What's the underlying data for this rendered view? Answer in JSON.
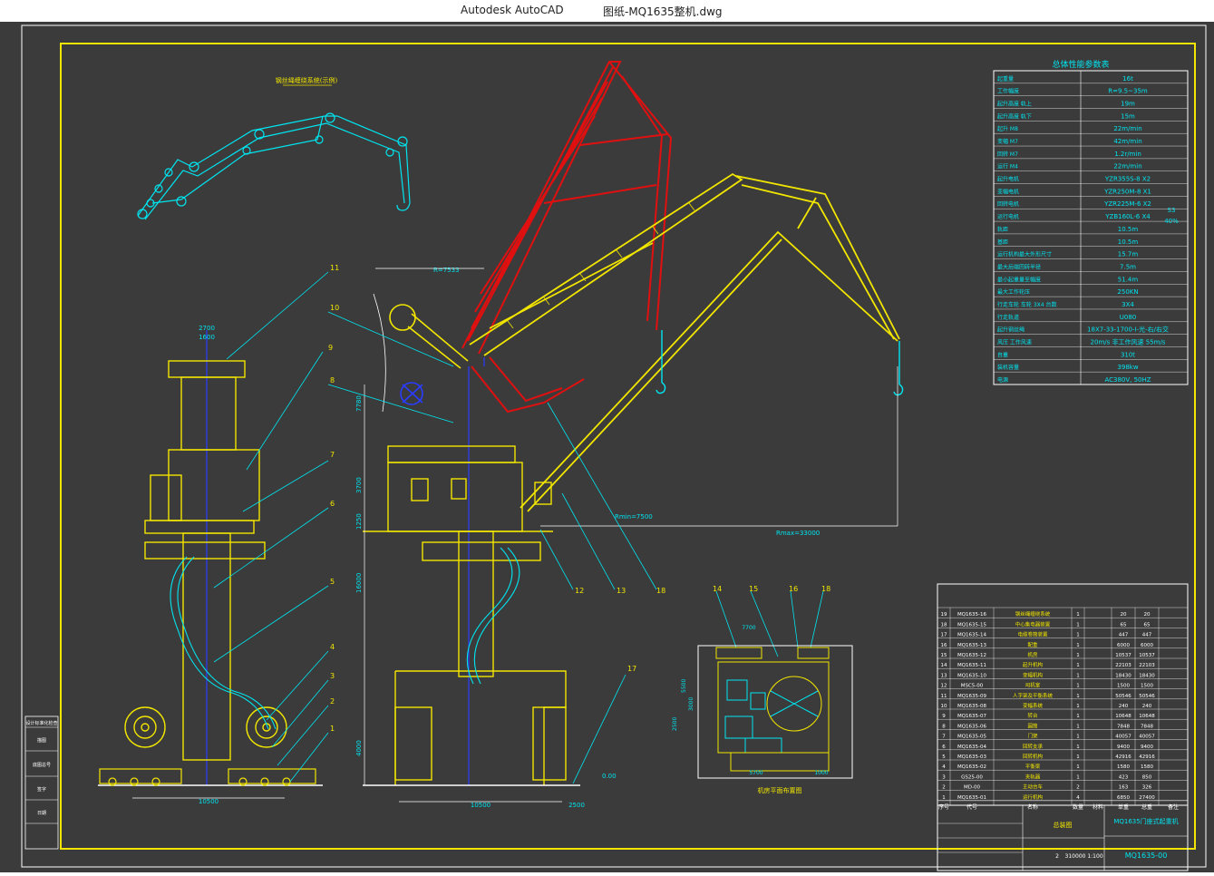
{
  "window": {
    "app_name": "Autodesk AutoCAD",
    "document_title": "图纸-MQ1635整机.dwg"
  },
  "colors": {
    "background": "#3b3b3b",
    "frame": "#ffffff",
    "border": "#f2e600",
    "cyan": "#00e5f0",
    "yellow": "#f2e600",
    "red": "#e01010",
    "blue": "#2a3cff",
    "green": "#2ee82e"
  },
  "drawing": {
    "small_caption": "钢丝绳缠绕系统(示例)",
    "dims": {
      "d2700": "2700",
      "d1600": "1600",
      "d7533": "R=7533",
      "d7780": "7780",
      "d3700": "3700",
      "d1250": "1250",
      "d16000": "16000",
      "d4000": "4000",
      "d10500a": "10500",
      "d10500b": "10500",
      "d2500": "2500",
      "d0": "0.00",
      "rmin": "Rmin=7500",
      "rmax": "Rmax=33000"
    },
    "callouts": [
      "11",
      "10",
      "9",
      "8",
      "7",
      "6",
      "5",
      "4",
      "3",
      "2",
      "1",
      "12",
      "13",
      "18",
      "17",
      "14",
      "15",
      "16",
      "18"
    ],
    "plan_caption": "机房平面布置图",
    "plan_dims": {
      "w": "7700",
      "h1": "5500",
      "h2": "3000",
      "h3": "2500",
      "b1": "5700",
      "b2": "1000"
    }
  },
  "perf_table": {
    "title": "总体性能参数表",
    "rows": [
      {
        "label": "起重量",
        "value": "16t"
      },
      {
        "label": "工作幅度",
        "value": "R=9.5~35m"
      },
      {
        "label": "起升高度 轨上",
        "value": "19m"
      },
      {
        "label": "起升高度 轨下",
        "value": "15m"
      },
      {
        "label": "起升 M8",
        "value": "22m/min"
      },
      {
        "label": "变幅 M7",
        "value": "42m/min"
      },
      {
        "label": "回转 M7",
        "value": "1.2r/min"
      },
      {
        "label": "运行 M4",
        "value": "22m/min"
      },
      {
        "label": "起升电机",
        "value": "YZR355S-8 X2"
      },
      {
        "label": "变幅电机",
        "value": "YZR250M-8 X1"
      },
      {
        "label": "回转电机",
        "value": "YZR225M-6 X2"
      },
      {
        "label": "运行电机",
        "value": "YZB160L-6 X4"
      },
      {
        "label": "轨距",
        "value": "10.5m"
      },
      {
        "label": "基距",
        "value": "10.5m"
      },
      {
        "label": "运行机构最大外形尺寸",
        "value": "15.7m"
      },
      {
        "label": "最大后端回转半径",
        "value": "7.5m"
      },
      {
        "label": "最小起重量至幅度",
        "value": "51.4m"
      },
      {
        "label": "最大工作轮压",
        "value": "250KN"
      },
      {
        "label": "行走车轮 车轮 3X4 台数",
        "value": "3X4"
      },
      {
        "label": "行走轨道",
        "value": "U080"
      },
      {
        "label": "起升钢丝绳",
        "value": "18X7-33-1700-I-光-右/右交"
      },
      {
        "label": "风压 工作风速",
        "value": "20m/s 非工作风速 55m/s"
      },
      {
        "label": "自重",
        "value": "310t"
      },
      {
        "label": "装机容量",
        "value": "398kw"
      },
      {
        "label": "电源",
        "value": "AC380V, 50HZ"
      }
    ],
    "side_note": [
      "S3",
      "40%"
    ]
  },
  "parts_list": {
    "rows": [
      [
        "19",
        "MQ1635-16",
        "钢丝绳缠绕系统",
        "1",
        "",
        "20",
        "20"
      ],
      [
        "18",
        "MQ1635-15",
        "中心集电器装置",
        "1",
        "",
        "65",
        "65"
      ],
      [
        "17",
        "MQ1635-14",
        "电缆卷筒装置",
        "1",
        "",
        "447",
        "447"
      ],
      [
        "16",
        "MQ1635-13",
        "配重",
        "1",
        "",
        "6000",
        "6000"
      ],
      [
        "15",
        "MQ1635-12",
        "机房",
        "1",
        "",
        "10537",
        "10537"
      ],
      [
        "14",
        "MQ1635-11",
        "起升机构",
        "1",
        "",
        "22103",
        "22103"
      ],
      [
        "13",
        "MQ1635-10",
        "变幅机构",
        "1",
        "",
        "18430",
        "18430"
      ],
      [
        "12",
        "MSC5-00",
        "司机室",
        "1",
        "",
        "1500",
        "1500"
      ],
      [
        "11",
        "MQ1635-09",
        "人字架及平衡系统",
        "1",
        "",
        "50546",
        "50546"
      ],
      [
        "10",
        "MQ1635-08",
        "变幅系统",
        "1",
        "",
        "240",
        "240"
      ],
      [
        "9",
        "MQ1635-07",
        "转台",
        "1",
        "",
        "10648",
        "10648"
      ],
      [
        "8",
        "MQ1635-06",
        "圆筒",
        "1",
        "",
        "7848",
        "7848"
      ],
      [
        "7",
        "MQ1635-05",
        "门架",
        "1",
        "",
        "40057",
        "40057"
      ],
      [
        "6",
        "MQ1635-04",
        "回转支承",
        "1",
        "",
        "9400",
        "9400"
      ],
      [
        "5",
        "MQ1635-03",
        "回转机构",
        "1",
        "",
        "42916",
        "42916"
      ],
      [
        "4",
        "MQ1635-02",
        "平衡梁",
        "1",
        "",
        "1580",
        "1580"
      ],
      [
        "3",
        "GS25-00",
        "夹轨器",
        "1",
        "",
        "423",
        "850"
      ],
      [
        "2",
        "MD-00",
        "主动台车",
        "2",
        "",
        "163",
        "326"
      ],
      [
        "1",
        "MQ1635-01",
        "运行机构",
        "4",
        "",
        "6850",
        "27400"
      ]
    ],
    "header": [
      "序号",
      "代号",
      "名称",
      "数量",
      "材料",
      "单重",
      "总重",
      "备注"
    ],
    "assembly_label": "总装图",
    "drawing_name": "MQ1635门座式起重机",
    "drawing_number": "MQ1635-00",
    "scale": "1:100",
    "weight": "310000",
    "sheet": "2"
  },
  "left_block": {
    "label": "设计标准化检查",
    "rows": [
      "描图",
      "底图总号",
      "签字",
      "日期"
    ]
  }
}
